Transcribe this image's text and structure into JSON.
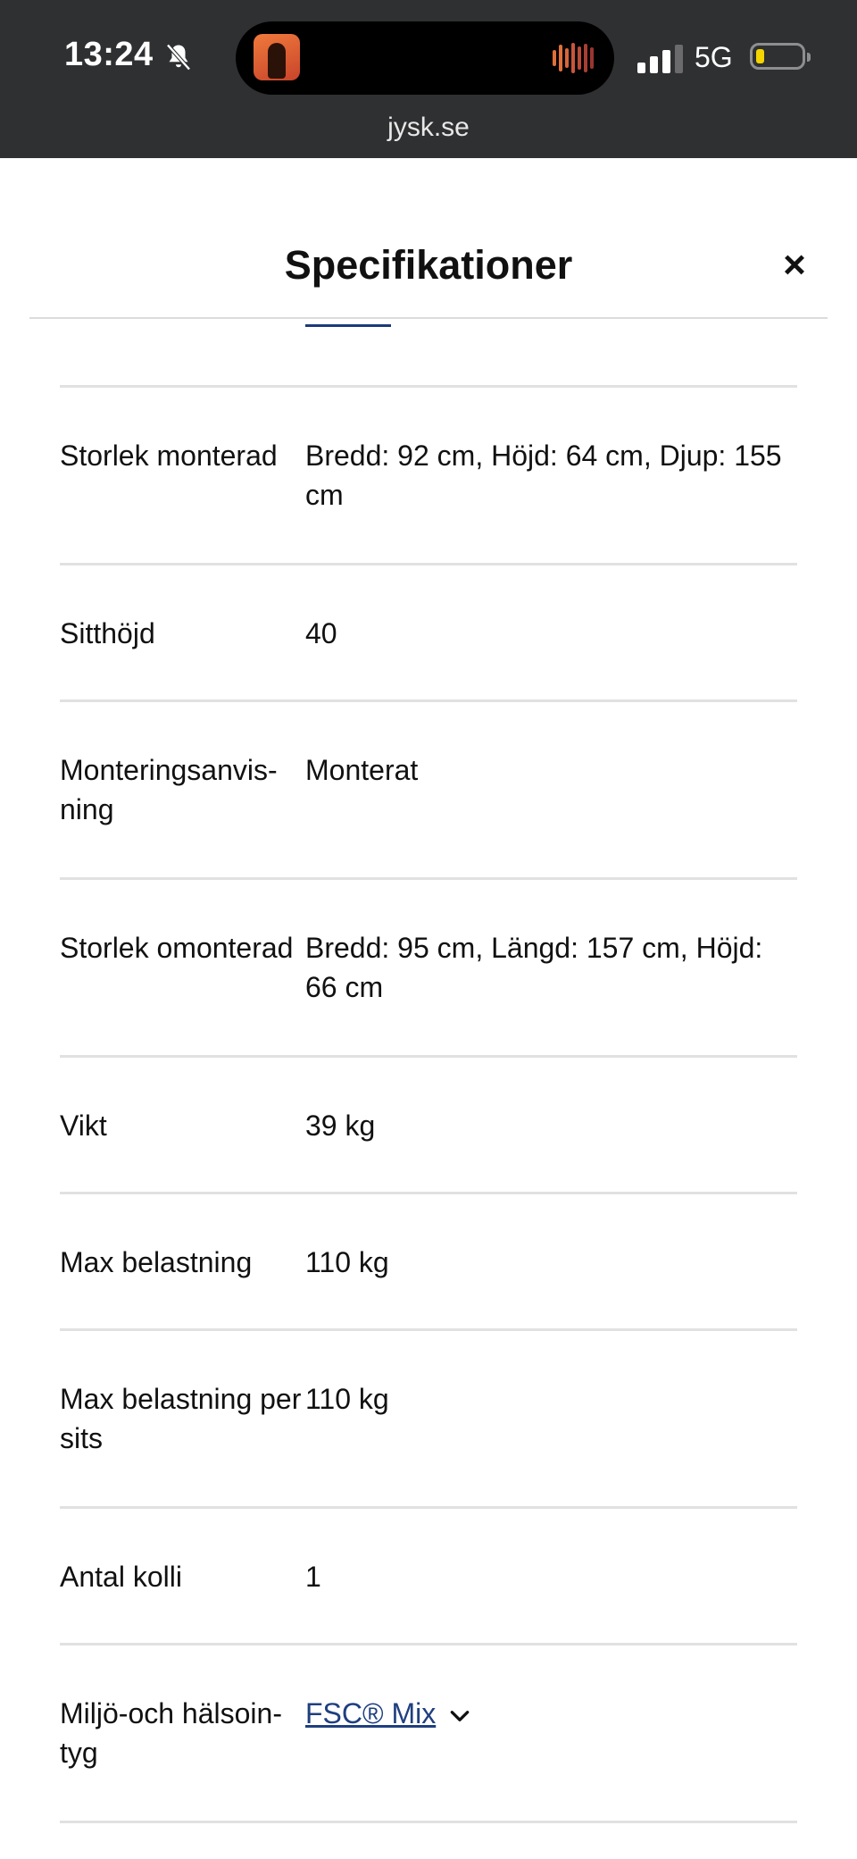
{
  "status_bar": {
    "time": "13:24",
    "network": "5G",
    "url": "jysk.se"
  },
  "sheet": {
    "title": "Specifikationer",
    "close_symbol": "×"
  },
  "specs": [
    {
      "label": "Storlek monterad",
      "value": "Bredd: 92 cm, Höjd: 64 cm, Djup: 155 cm"
    },
    {
      "label": "Sitthöjd",
      "value": "40"
    },
    {
      "label": "Monteringsanvis-ning",
      "value": "Monterat"
    },
    {
      "label": "Storlek omonterad",
      "value": "Bredd: 95 cm, Längd: 157 cm, Höjd: 66 cm"
    },
    {
      "label": "Vikt",
      "value": "39 kg"
    },
    {
      "label": "Max belastning",
      "value": "110 kg"
    },
    {
      "label": "Max belastning per sits",
      "value": "110 kg"
    },
    {
      "label": "Antal kolli",
      "value": "1"
    },
    {
      "label": "Miljö-och hälsoin-tyg",
      "value": "FSC® Mix"
    }
  ],
  "colors": {
    "status_bg": "#2f3032",
    "link": "#1f3f7f",
    "divider": "#e1e1e1",
    "battery_fill": "#f5d500"
  },
  "icons": [
    "bell-slash-icon",
    "album-art-icon",
    "waveform-icon",
    "signal-icon",
    "battery-icon",
    "close-icon",
    "chevron-down-icon"
  ]
}
